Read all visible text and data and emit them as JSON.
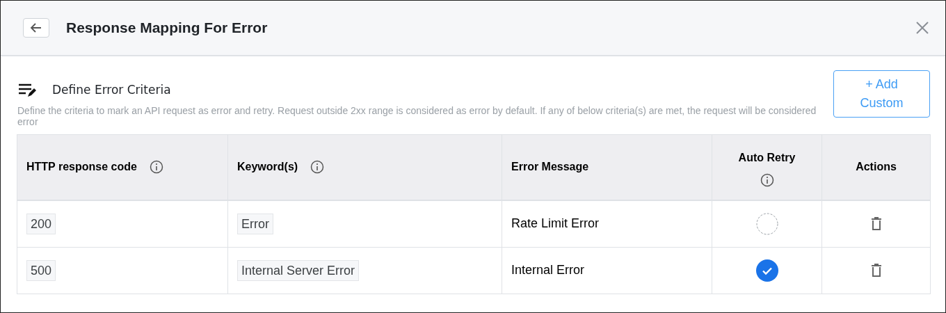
{
  "window": {
    "title": "Response Mapping For Error"
  },
  "section": {
    "title": "Define Error Criteria",
    "description": "Define the criteria to mark an API request as error and retry. Request outside 2xx range is considered as error by default. If any of below criteria(s) are met, the request will be considered error",
    "add_button": "+ Add Custom"
  },
  "table": {
    "columns": [
      {
        "label": "HTTP response code",
        "info": true
      },
      {
        "label": "Keyword(s)",
        "info": true
      },
      {
        "label": "Error Message",
        "info": false
      },
      {
        "label": "Auto Retry",
        "info": true
      },
      {
        "label": "Actions",
        "info": false
      }
    ],
    "rows": [
      {
        "code": "200",
        "keyword": "Error",
        "message": "Rate Limit Error",
        "auto_retry": false
      },
      {
        "code": "500",
        "keyword": "Internal Server Error",
        "message": "Internal Error",
        "auto_retry": true
      }
    ]
  }
}
